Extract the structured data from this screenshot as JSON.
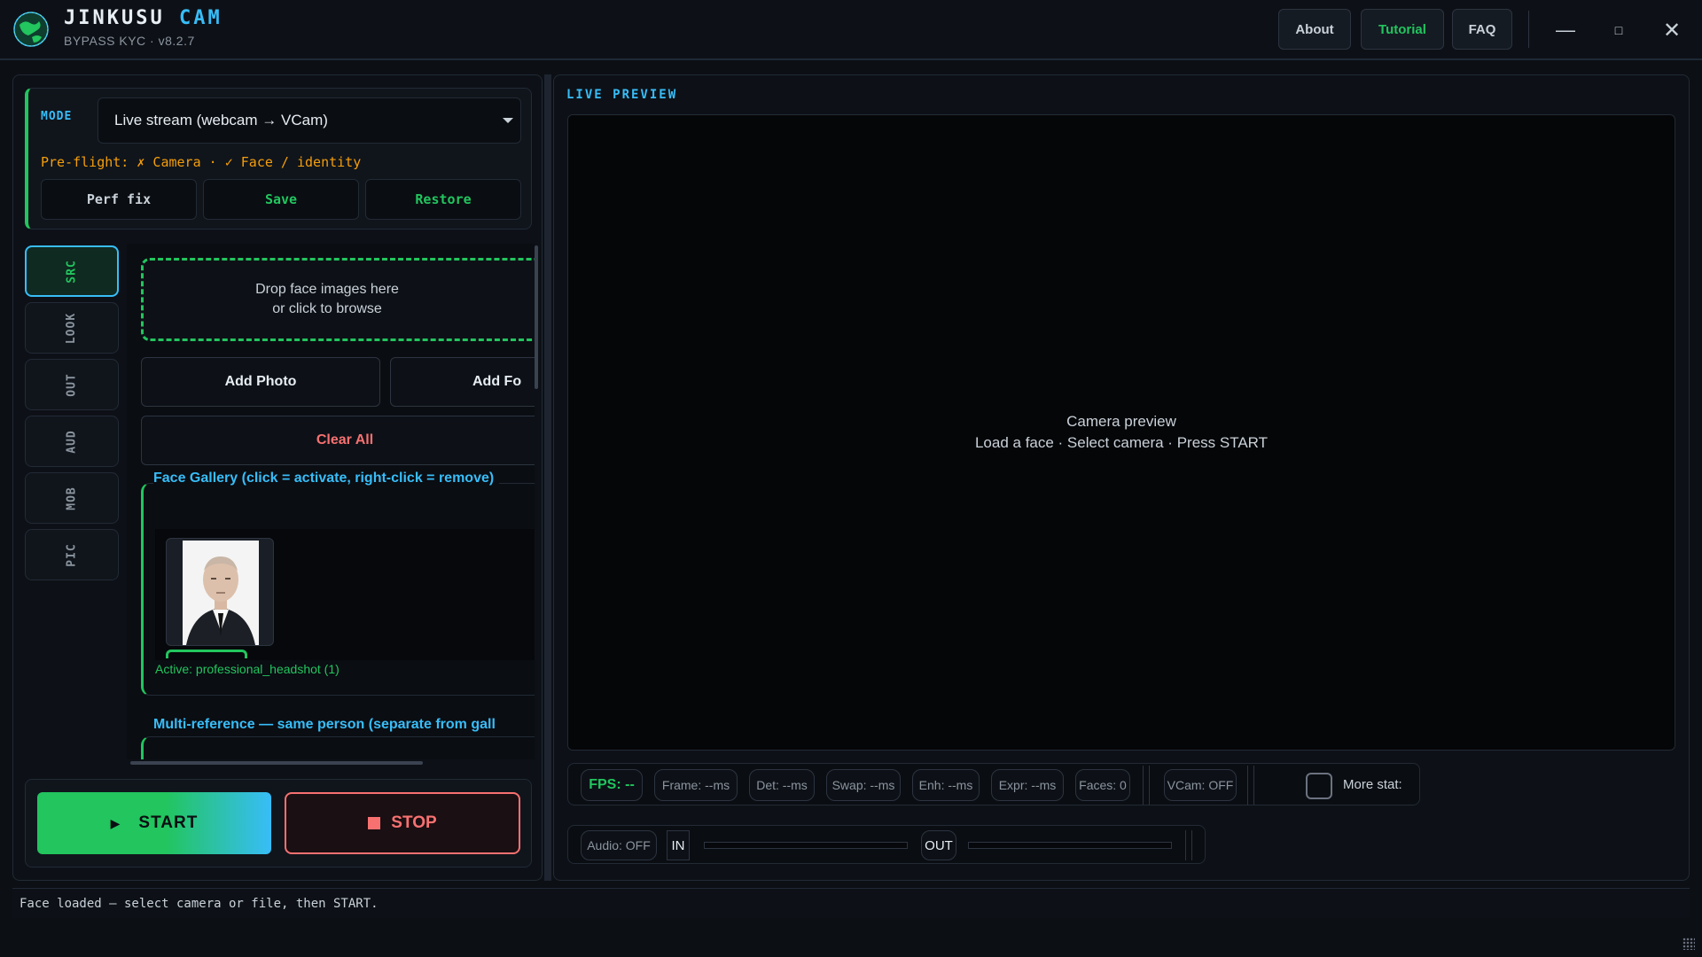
{
  "app": {
    "title_main": "JINKUSU",
    "title_accent": "CAM",
    "subtitle": "BYPASS KYC · v8.2.7",
    "logo_icon": "globe-logo-icon"
  },
  "header": {
    "about_label": "About",
    "tutorial_label": "Tutorial",
    "faq_label": "FAQ",
    "minimize_glyph": "—",
    "maximize_glyph": "□",
    "close_glyph": "✕"
  },
  "mode": {
    "label": "MODE",
    "selected": "Live stream (webcam → VCam)",
    "preflight": "Pre-flight: ✗ Camera · ✓ Face / identity",
    "perf_fix_label": "Perf fix",
    "save_label": "Save",
    "restore_label": "Restore"
  },
  "tabs": [
    {
      "label": "SRC",
      "active": true
    },
    {
      "label": "LOOK",
      "active": false
    },
    {
      "label": "OUT",
      "active": false
    },
    {
      "label": "AUD",
      "active": false
    },
    {
      "label": "MOB",
      "active": false
    },
    {
      "label": "PIC",
      "active": false
    }
  ],
  "src": {
    "drop_line1": "Drop face images here",
    "drop_line2": "or click to browse",
    "add_photo_label": "Add Photo",
    "add_folder_label": "Add Fo",
    "clear_all_label": "Clear All",
    "gallery_title": "Face Gallery  (click = activate, right-click = remove)",
    "active_label": "Active: professional_headshot (1)",
    "multiref_title": "Multi-reference — same person (separate from gall"
  },
  "controls": {
    "start_label": "START",
    "start_icon": "▶",
    "stop_label": "STOP"
  },
  "preview": {
    "label": "LIVE PREVIEW",
    "placeholder_line1": "Camera preview",
    "placeholder_line2": "Load a face  ·  Select camera  ·  Press START"
  },
  "stats": {
    "fps": "FPS: --",
    "frame": "Frame: --ms",
    "det": "Det: --ms",
    "swap": "Swap: --ms",
    "enh": "Enh: --ms",
    "expr": "Expr: --ms",
    "faces": "Faces: 0",
    "vcam": "VCam: OFF",
    "more_stats_label": "More stat:",
    "more_stats_checked": false
  },
  "audio": {
    "status": "Audio: OFF",
    "in_label": "IN",
    "out_label": "OUT"
  },
  "status_bar": {
    "message": "Face loaded — select camera or file, then START."
  },
  "colors": {
    "accent_green": "#22c55e",
    "accent_blue": "#38bdf8",
    "warning_amber": "#f59e0b",
    "danger_red": "#f87171",
    "background": "#0c0f14"
  }
}
